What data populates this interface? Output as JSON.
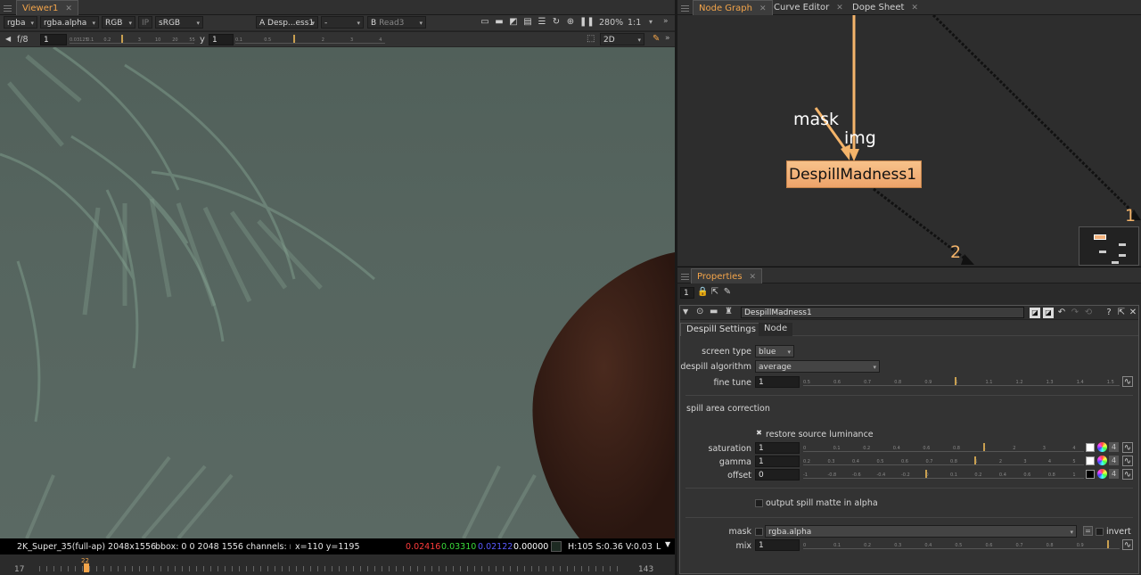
{
  "viewer": {
    "tab": "Viewer1",
    "channels": "rgba",
    "alpha_channel": "rgba.alpha",
    "display": "RGB",
    "ip": "IP",
    "lut": "sRGB",
    "input_a_label": "A",
    "input_a": "Desp...ess1",
    "wipe": "-",
    "input_b_label": "B",
    "input_b": "Read3",
    "zoom": "280%",
    "ratio": "1:1",
    "fstop": "f/8",
    "gain_value": "1",
    "gamma_label": "y",
    "gamma_value": "1",
    "gain_ticks": [
      "0.03125",
      "0.1",
      "0.2",
      "1",
      "3",
      "10",
      "20",
      "55"
    ],
    "gamma_ticks": [
      "0.1",
      "0.5",
      "1",
      "2",
      "3",
      "4"
    ],
    "view_mode": "2D"
  },
  "status": {
    "format": "2K_Super_35(full-ap) 2048x1556",
    "bbox": "bbox: 0 0 2048 1556 channels: rg",
    "coords": "x=110 y=1195",
    "r": "0.02416",
    "g": "0.03310",
    "b": "0.02122",
    "a": "0.00000",
    "hsv": "H:105 S:0.36 V:0.03",
    "l": "L"
  },
  "timeline": {
    "start": "17",
    "current": "22",
    "end": "143"
  },
  "nodegraph": {
    "tabs": [
      {
        "label": "Node Graph"
      },
      {
        "label": "Curve Editor"
      },
      {
        "label": "Dope Sheet"
      }
    ],
    "mask_label": "mask",
    "img_label": "img",
    "node_name": "DespillMadness1",
    "input_1": "1",
    "input_2": "2"
  },
  "properties": {
    "tab": "Properties",
    "max_panels": "1",
    "node_name": "DespillMadness1",
    "subtabs": [
      {
        "label": "Despill Settings"
      },
      {
        "label": "Node"
      }
    ],
    "screen_type_label": "screen type",
    "screen_type": "blue",
    "algorithm_label": "despill algorithm",
    "algorithm": "average",
    "fine_tune_label": "fine tune",
    "fine_tune": "1",
    "fine_ticks": [
      "0.5",
      "0.6",
      "0.7",
      "0.8",
      "0.9",
      "1",
      "1.1",
      "1.2",
      "1.3",
      "1.4",
      "1.5"
    ],
    "spill_section": "spill area correction",
    "restore_label": "restore source luminance",
    "saturation_label": "saturation",
    "saturation": "1",
    "sat_ticks": [
      "0",
      "0.1",
      "0.2",
      "0.4",
      "0.6",
      "0.8",
      "1",
      "2",
      "3",
      "4"
    ],
    "gamma_label": "gamma",
    "gamma": "1",
    "gam_ticks": [
      "0.2",
      "0.3",
      "0.4",
      "0.5",
      "0.6",
      "0.7",
      "0.8",
      "1",
      "2",
      "3",
      "4",
      "5"
    ],
    "offset_label": "offset",
    "offset": "0",
    "off_ticks": [
      "-1",
      "-0.8",
      "-0.6",
      "-0.4",
      "-0.2",
      "0",
      "0.1",
      "0.2",
      "0.4",
      "0.6",
      "0.8",
      "1"
    ],
    "channel_count": "4",
    "output_label": "output spill matte in alpha",
    "mask_label": "mask",
    "mask_value": "rgba.alpha",
    "invert_label": "invert",
    "mix_label": "mix",
    "mix": "1",
    "mix_ticks": [
      "0",
      "0.1",
      "0.2",
      "0.3",
      "0.4",
      "0.5",
      "0.6",
      "0.7",
      "0.8",
      "0.9",
      "1"
    ]
  },
  "colors": {
    "accent": "#f4a54a",
    "node": "#f2b07a",
    "r": "#ff3b3b",
    "g": "#3bdc3b",
    "b": "#4a4aff"
  }
}
